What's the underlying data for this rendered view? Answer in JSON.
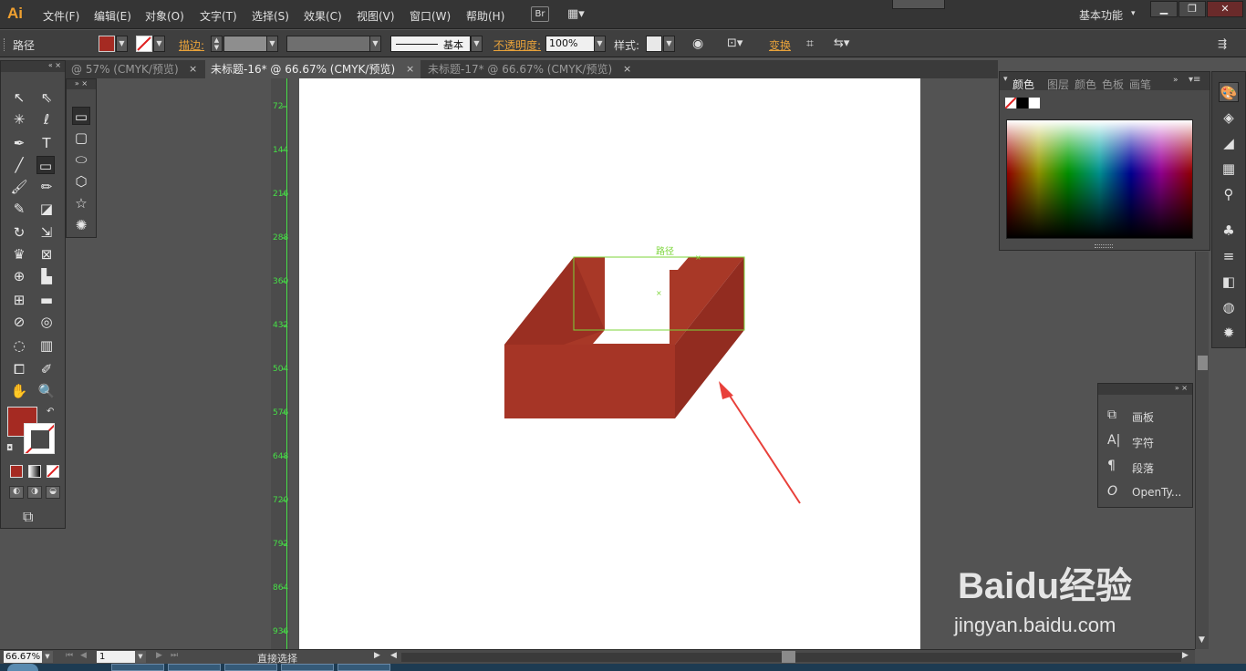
{
  "app": {
    "logo": "Ai"
  },
  "menu": [
    "文件(F)",
    "编辑(E)",
    "对象(O)",
    "文字(T)",
    "选择(S)",
    "效果(C)",
    "视图(V)",
    "窗口(W)",
    "帮助(H)"
  ],
  "menu_extra": {
    "bridge": "Br",
    "workspace": "基本功能"
  },
  "control": {
    "selection_label": "路径",
    "stroke_label": "描边:",
    "stroke_style": "基本",
    "opacity_label": "不透明度:",
    "opacity_value": "100%",
    "style_label": "样式:",
    "transform_label": "变换",
    "fill_color": "#a52a22"
  },
  "tabs": [
    {
      "label": "@ 57% (CMYK/预览)",
      "close": "×"
    },
    {
      "label": "未标题-16* @ 66.67% (CMYK/预览)",
      "close": "×"
    },
    {
      "label": "未标题-17* @ 66.67% (CMYK/预览)",
      "close": "×"
    }
  ],
  "ruler_labels": [
    "72",
    "144",
    "216",
    "288",
    "360",
    "432",
    "504",
    "576",
    "648",
    "720",
    "792",
    "864",
    "936"
  ],
  "canvas": {
    "path_label": "路径",
    "shape_colors": {
      "front": "#a63526",
      "right": "#922c20",
      "left": "#9a2f22",
      "top_face": "#a83827"
    },
    "selection_color": "#7cd63a",
    "arrow_color": "#e8403a"
  },
  "color_panel": {
    "tabs": [
      "颜色",
      "图层",
      "颜色",
      "色板",
      "画笔"
    ]
  },
  "float_panel": {
    "items": [
      {
        "icon": "artboard-icon",
        "label": "画板"
      },
      {
        "icon": "character-icon",
        "label": "字符"
      },
      {
        "icon": "paragraph-icon",
        "label": "段落"
      },
      {
        "icon": "opentype-icon",
        "label": "OpenTy..."
      }
    ]
  },
  "status": {
    "zoom": "66.67%",
    "page": "1",
    "tool": "直接选择"
  },
  "watermark": {
    "brand": "Baidu经验",
    "url": "jingyan.baidu.com"
  }
}
